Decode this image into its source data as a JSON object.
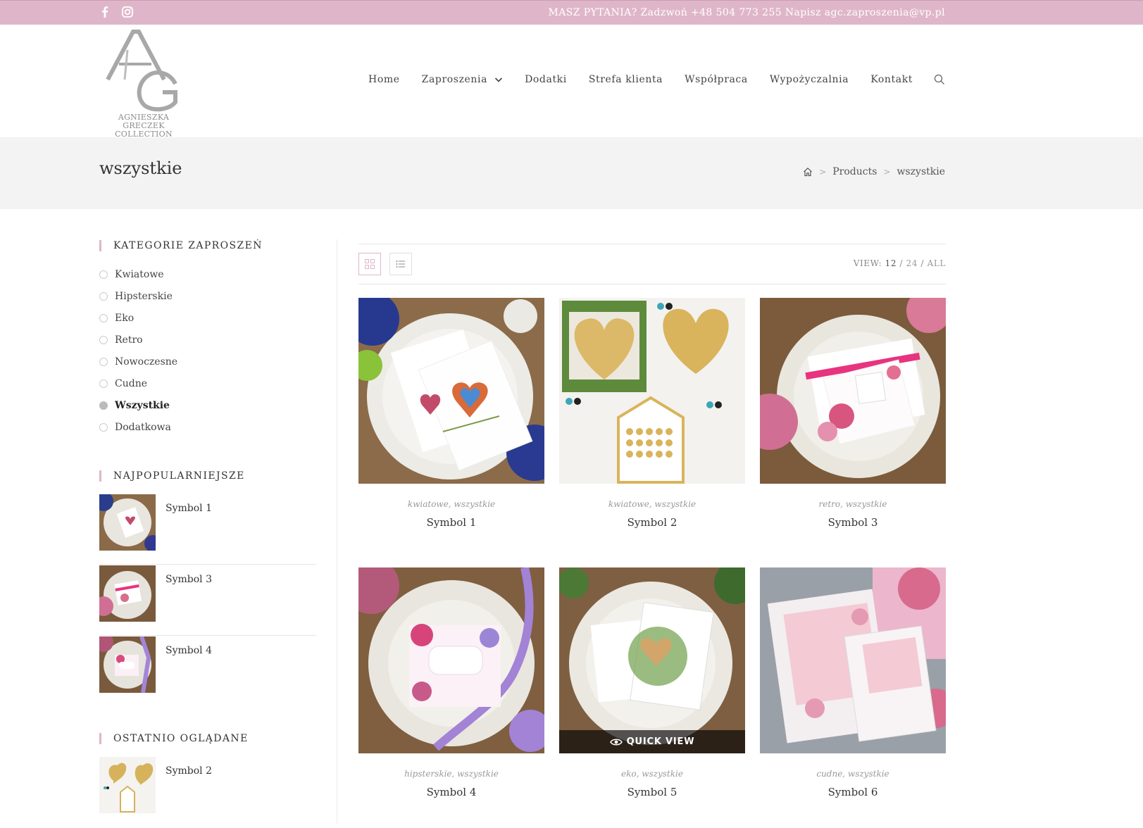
{
  "topbar": {
    "contact": "MASZ PYTANIA? Zadzwoń +48 504 773 255 Napisz agc.zaproszenia@vp.pl",
    "social": [
      "facebook-icon",
      "instagram-icon"
    ]
  },
  "logo": {
    "tagline_line1": "AGNIESZKA GRECZEK",
    "tagline_line2": "COLLECTION"
  },
  "nav": {
    "items": [
      "Home",
      "Zaproszenia",
      "Dodatki",
      "Strefa klienta",
      "Współpraca",
      "Wypożyczalnia",
      "Kontakt"
    ]
  },
  "page": {
    "title": "wszystkie",
    "breadcrumb": [
      "Products",
      "wszystkie"
    ]
  },
  "sidebar": {
    "categories_title": "KATEGORIE ZAPROSZEŃ",
    "categories": [
      "Kwiatowe",
      "Hipsterskie",
      "Eko",
      "Retro",
      "Nowoczesne",
      "Cudne",
      "Wszystkie",
      "Dodatkowa"
    ],
    "active_category": "Wszystkie",
    "popular_title": "NAJPOPULARNIEJSZE",
    "popular": [
      "Symbol 1",
      "Symbol 3",
      "Symbol 4"
    ],
    "recent_title": "OSTATNIO OGLĄDANE",
    "recent": [
      "Symbol 2"
    ]
  },
  "toolbar": {
    "view_label": "VIEW:",
    "per_page": [
      "12",
      "24",
      "ALL"
    ],
    "per_page_current": "12"
  },
  "products": [
    {
      "cats": "kwiatowe, wszystkie",
      "name": "Symbol 1"
    },
    {
      "cats": "kwiatowe, wszystkie",
      "name": "Symbol 2"
    },
    {
      "cats": "retro, wszystkie",
      "name": "Symbol 3"
    },
    {
      "cats": "hipsterskie, wszystkie",
      "name": "Symbol 4"
    },
    {
      "cats": "eko, wszystkie",
      "name": "Symbol 5"
    },
    {
      "cats": "cudne, wszystkie",
      "name": "Symbol 6"
    }
  ],
  "quickview_label": "QUICK VIEW",
  "colors": {
    "accent": "#dfb6c9",
    "title_band": "#f3f3f3"
  }
}
